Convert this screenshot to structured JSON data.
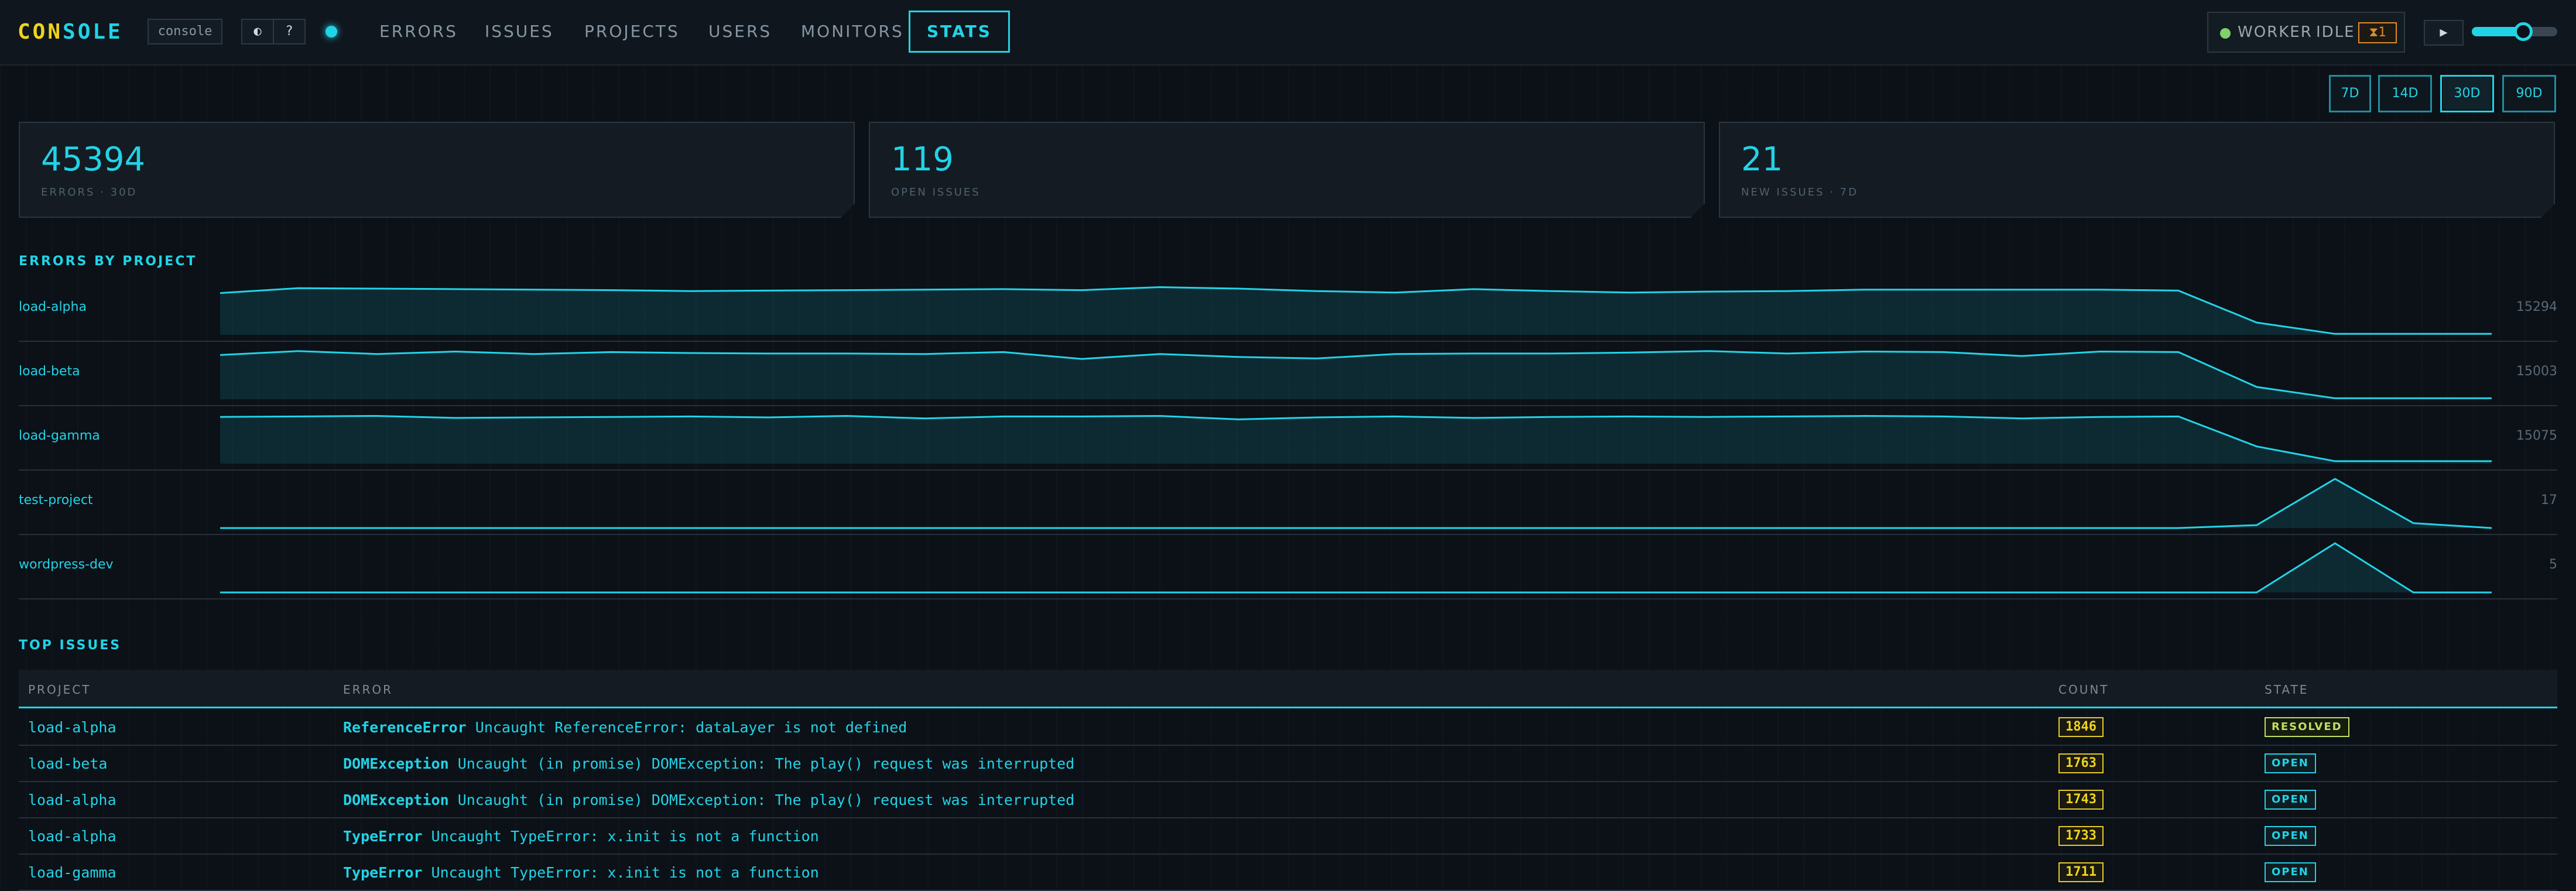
{
  "header": {
    "logo_part1": "CON",
    "logo_part2": "SOLE",
    "env_badge": "console",
    "theme_icon": "◐",
    "help_icon": "?",
    "nav": [
      "ERRORS",
      "ISSUES",
      "PROJECTS",
      "USERS",
      "MONITORS",
      "STATS"
    ],
    "active_nav": "STATS",
    "worker": {
      "label": "WORKER",
      "state": "IDLE",
      "count": "⧗1",
      "dot_color": "#7fd16a"
    },
    "play_icon": "▶",
    "speed_slider": 0.6
  },
  "ranges": [
    "7D",
    "14D",
    "30D",
    "90D"
  ],
  "active_range": "30D",
  "stats": [
    {
      "value": "45394",
      "label": "ERRORS · 30D"
    },
    {
      "value": "119",
      "label": "OPEN ISSUES"
    },
    {
      "value": "21",
      "label": "NEW ISSUES · 7D"
    }
  ],
  "errors_by_project": {
    "title": "ERRORS BY PROJECT",
    "projects": [
      {
        "name": "load-alpha",
        "total": "15294",
        "series": [
          0.85,
          0.95,
          0.94,
          0.93,
          0.92,
          0.91,
          0.89,
          0.9,
          0.91,
          0.92,
          0.93,
          0.91,
          0.97,
          0.94,
          0.89,
          0.86,
          0.93,
          0.89,
          0.86,
          0.88,
          0.89,
          0.92,
          0.92,
          0.92,
          0.92,
          0.9,
          0.25,
          0.02,
          0.02,
          0.02
        ]
      },
      {
        "name": "load-beta",
        "total": "15003",
        "series": [
          0.9,
          0.98,
          0.92,
          0.97,
          0.92,
          0.96,
          0.94,
          0.93,
          0.93,
          0.92,
          0.96,
          0.82,
          0.92,
          0.86,
          0.83,
          0.92,
          0.93,
          0.93,
          0.95,
          0.98,
          0.93,
          0.97,
          0.96,
          0.88,
          0.97,
          0.96,
          0.25,
          0.02,
          0.02,
          0.02
        ]
      },
      {
        "name": "load-gamma",
        "total": "15075",
        "series": [
          0.95,
          0.96,
          0.97,
          0.93,
          0.94,
          0.95,
          0.96,
          0.94,
          0.97,
          0.92,
          0.96,
          0.96,
          0.97,
          0.9,
          0.94,
          0.96,
          0.93,
          0.95,
          0.96,
          0.95,
          0.96,
          0.97,
          0.96,
          0.92,
          0.95,
          0.96,
          0.35,
          0.05,
          0.05,
          0.05
        ]
      },
      {
        "name": "test-project",
        "total": "17",
        "series": [
          0,
          0,
          0,
          0,
          0,
          0,
          0,
          0,
          0,
          0,
          0,
          0,
          0,
          0,
          0,
          0,
          0,
          0,
          0,
          0,
          0,
          0,
          0,
          0,
          0,
          0,
          0.06,
          1.0,
          0.1,
          0
        ]
      },
      {
        "name": "wordpress-dev",
        "total": "5",
        "series": [
          0,
          0,
          0,
          0,
          0,
          0,
          0,
          0,
          0,
          0,
          0,
          0,
          0,
          0,
          0,
          0,
          0,
          0,
          0,
          0,
          0,
          0,
          0,
          0,
          0,
          0,
          0,
          1.0,
          0,
          0
        ]
      }
    ]
  },
  "top_issues": {
    "title": "TOP ISSUES",
    "columns": [
      "PROJECT",
      "ERROR",
      "COUNT",
      "STATE"
    ],
    "rows": [
      {
        "project": "load-alpha",
        "type": "ReferenceError",
        "message": "Uncaught ReferenceError: dataLayer is not defined",
        "count": "1846",
        "state": "RESOLVED"
      },
      {
        "project": "load-beta",
        "type": "DOMException",
        "message": "Uncaught (in promise) DOMException: The play() request was interrupted",
        "count": "1763",
        "state": "OPEN"
      },
      {
        "project": "load-alpha",
        "type": "DOMException",
        "message": "Uncaught (in promise) DOMException: The play() request was interrupted",
        "count": "1743",
        "state": "OPEN"
      },
      {
        "project": "load-alpha",
        "type": "TypeError",
        "message": "Uncaught TypeError: x.init is not a function",
        "count": "1733",
        "state": "OPEN"
      },
      {
        "project": "load-gamma",
        "type": "TypeError",
        "message": "Uncaught TypeError: x.init is not a function",
        "count": "1711",
        "state": "OPEN"
      }
    ]
  }
}
